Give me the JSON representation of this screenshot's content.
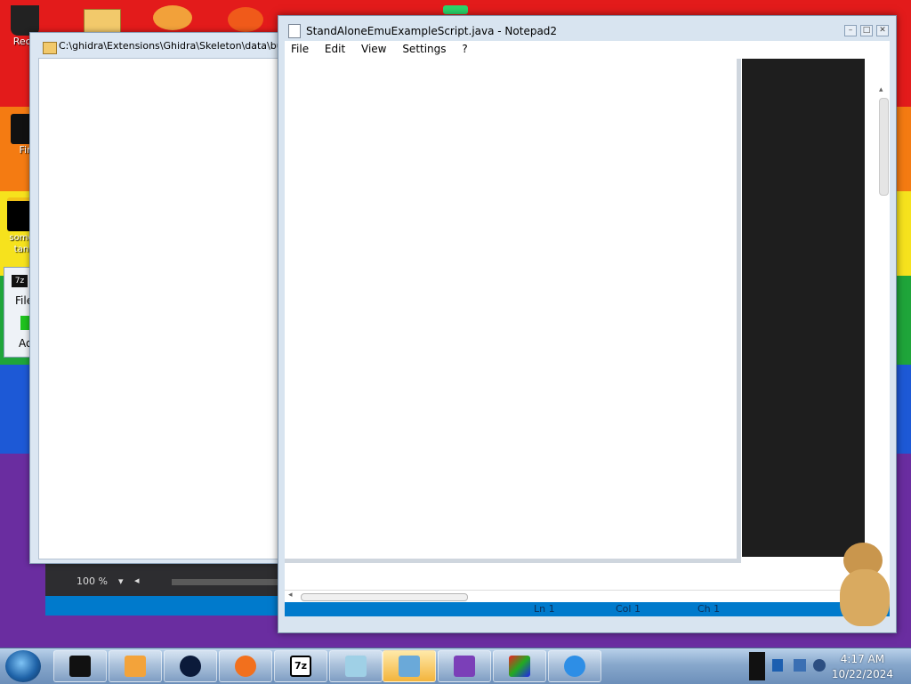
{
  "desktop": {
    "icons": [
      {
        "label": "Recy"
      },
      {
        "label": "Fir"
      },
      {
        "label": "some\ntan"
      },
      {
        "label": "Ad"
      }
    ]
  },
  "explorer_window": {
    "title": "C:\\ghidra\\Extensions\\Ghidra\\Skeleton\\data\\bu"
  },
  "sevenzip": {
    "menu_label": "File",
    "badge": "7z"
  },
  "vs_window": {
    "zoom": "100 %"
  },
  "notepad": {
    "title": "StandAloneEmuExampleScript.java - Notepad2",
    "menu": [
      "File",
      "Edit",
      "View",
      "Settings",
      "?"
    ],
    "status": {
      "ln": "Ln 1",
      "col": "Col 1",
      "ch": "Ch 1"
    }
  },
  "taskbar": {
    "time": "4:17 AM",
    "date": "10/22/2024",
    "sevenzip_label": "7z"
  },
  "colors": {
    "vs_blue": "#007acc",
    "vs_dark": "#2d2d30",
    "taskbar": "#88a8cc"
  }
}
